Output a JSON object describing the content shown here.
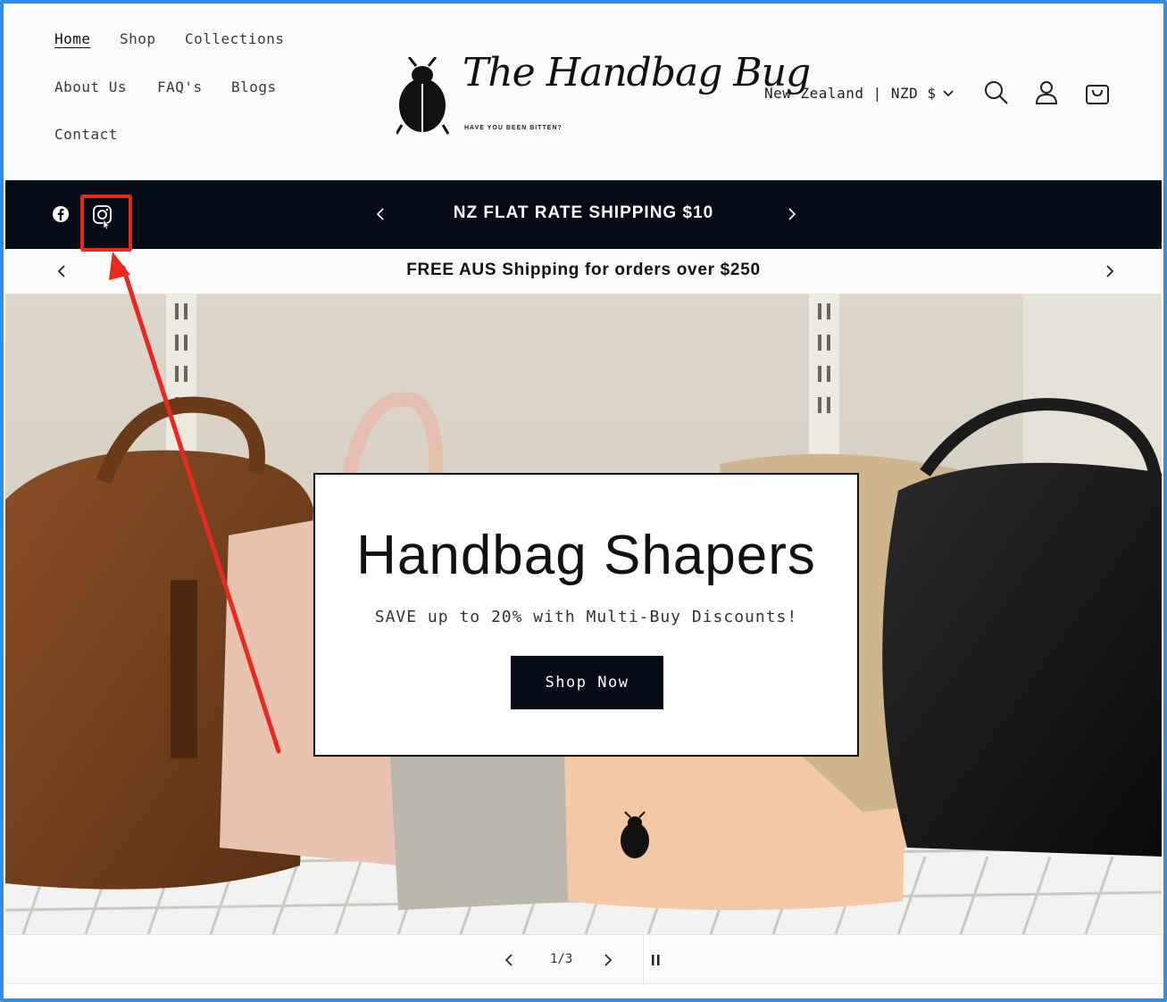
{
  "nav": {
    "home": "Home",
    "shop": "Shop",
    "collections": "Collections",
    "about": "About Us",
    "faq": "FAQ's",
    "blogs": "Blogs",
    "contact": "Contact"
  },
  "logo": {
    "script": "The Handbag Bug",
    "tagline": "HAVE YOU BEEN BITTEN?"
  },
  "locale": {
    "label": "New Zealand | NZD $"
  },
  "icons": {
    "search": "search-icon",
    "account": "account-icon",
    "cart": "cart-icon",
    "facebook": "facebook-icon",
    "instagram": "instagram-icon"
  },
  "announcement": {
    "text": "NZ FLAT RATE SHIPPING $10"
  },
  "sub_announcement": {
    "text": "FREE AUS Shipping for orders over $250"
  },
  "hero": {
    "title": "Handbag Shapers",
    "subtitle": "SAVE up to 20% with Multi-Buy Discounts!",
    "button": "Shop Now"
  },
  "slider": {
    "counter": "1/3"
  },
  "colors": {
    "announcement_bg": "#050c18",
    "highlight": "#e62a20",
    "frame": "#2f8fe6"
  }
}
